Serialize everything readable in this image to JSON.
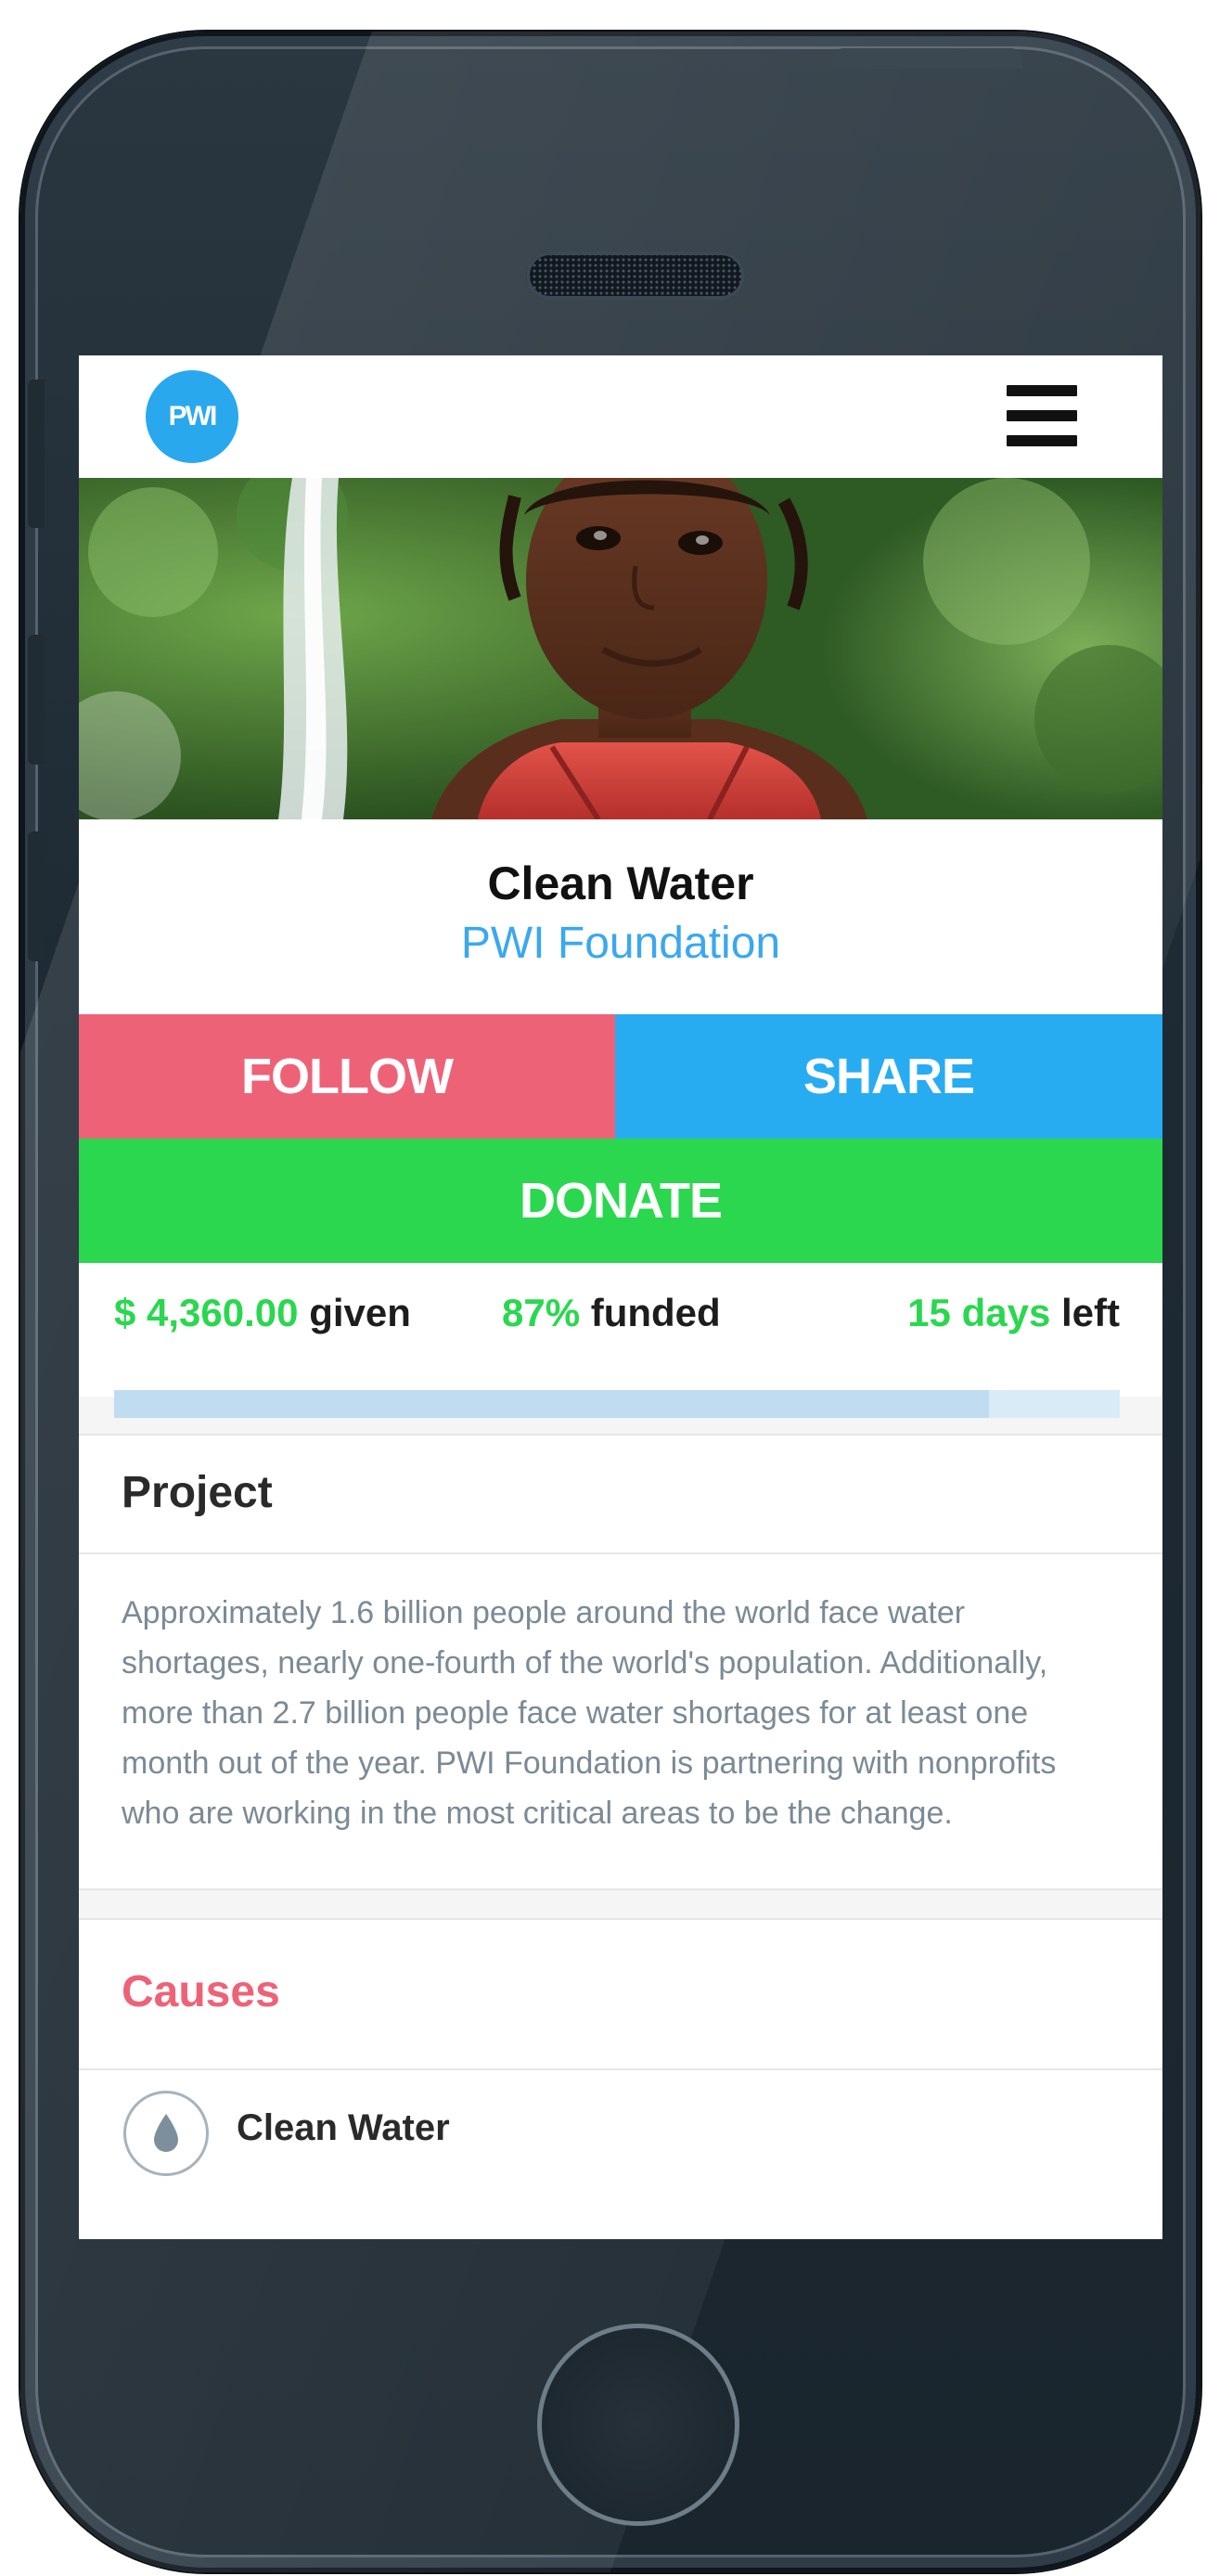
{
  "header": {
    "logo_text": "PWI"
  },
  "project": {
    "title": "Clean Water",
    "organization": "PWI Foundation"
  },
  "actions": {
    "follow": "FOLLOW",
    "share": "SHARE",
    "donate": "DONATE"
  },
  "stats": {
    "given_amount": "$ 4,360.00",
    "given_label": "given",
    "funded_percent": "87%",
    "funded_label": "funded",
    "days_value": "15 days",
    "days_label": "left",
    "progress_fraction": 0.87
  },
  "section_project": {
    "heading": "Project",
    "description": "Approximately 1.6 billion people around the world face water shortages, nearly one-fourth of the world's population. Additionally, more than 2.7 billion people face water shortages for at least one month out of the year. PWI Foundation is partnering with nonprofits who are working in the most critical areas to be the change."
  },
  "section_causes": {
    "heading": "Causes",
    "items": [
      {
        "label": "Clean Water",
        "icon": "water-drop-icon"
      }
    ]
  },
  "colors": {
    "follow": "#ee6278",
    "share": "#27acf2",
    "donate": "#2ad74f",
    "accent_green": "#2ad74f",
    "link_blue": "#3ba8ee"
  }
}
